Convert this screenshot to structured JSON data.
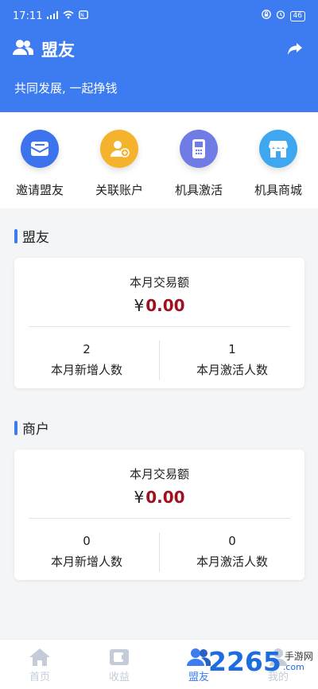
{
  "status": {
    "time": "17:11",
    "battery": "46"
  },
  "header": {
    "title": "盟友",
    "slogan": "共同发展, 一起挣钱"
  },
  "quick_actions": [
    {
      "label": "邀请盟友",
      "icon": "envelope-icon",
      "color": "#3d74ee"
    },
    {
      "label": "关联账户",
      "icon": "user-add-icon",
      "color": "#f5b22c"
    },
    {
      "label": "机具激活",
      "icon": "device-icon",
      "color": "#6f7ce6"
    },
    {
      "label": "机具商城",
      "icon": "store-icon",
      "color": "#3fa7f0"
    }
  ],
  "sections": [
    {
      "title": "盟友",
      "amount_label": "本月交易额",
      "currency": "¥",
      "amount": "0.00",
      "stats": [
        {
          "value": "2",
          "label": "本月新增人数"
        },
        {
          "value": "1",
          "label": "本月激活人数"
        }
      ]
    },
    {
      "title": "商户",
      "amount_label": "本月交易额",
      "currency": "¥",
      "amount": "0.00",
      "stats": [
        {
          "value": "0",
          "label": "本月新增人数"
        },
        {
          "value": "0",
          "label": "本月激活人数"
        }
      ]
    }
  ],
  "tabs": [
    {
      "label": "首页",
      "icon": "home-icon",
      "active": false
    },
    {
      "label": "收益",
      "icon": "wallet-icon",
      "active": false
    },
    {
      "label": "盟友",
      "icon": "users-icon",
      "active": true
    },
    {
      "label": "我的",
      "icon": "user-icon",
      "active": false
    }
  ],
  "watermark": {
    "brand": "2265",
    "suffix": ".com",
    "cn": "手游网"
  },
  "colors": {
    "primary": "#3d7cf0",
    "amount": "#a0101e"
  }
}
